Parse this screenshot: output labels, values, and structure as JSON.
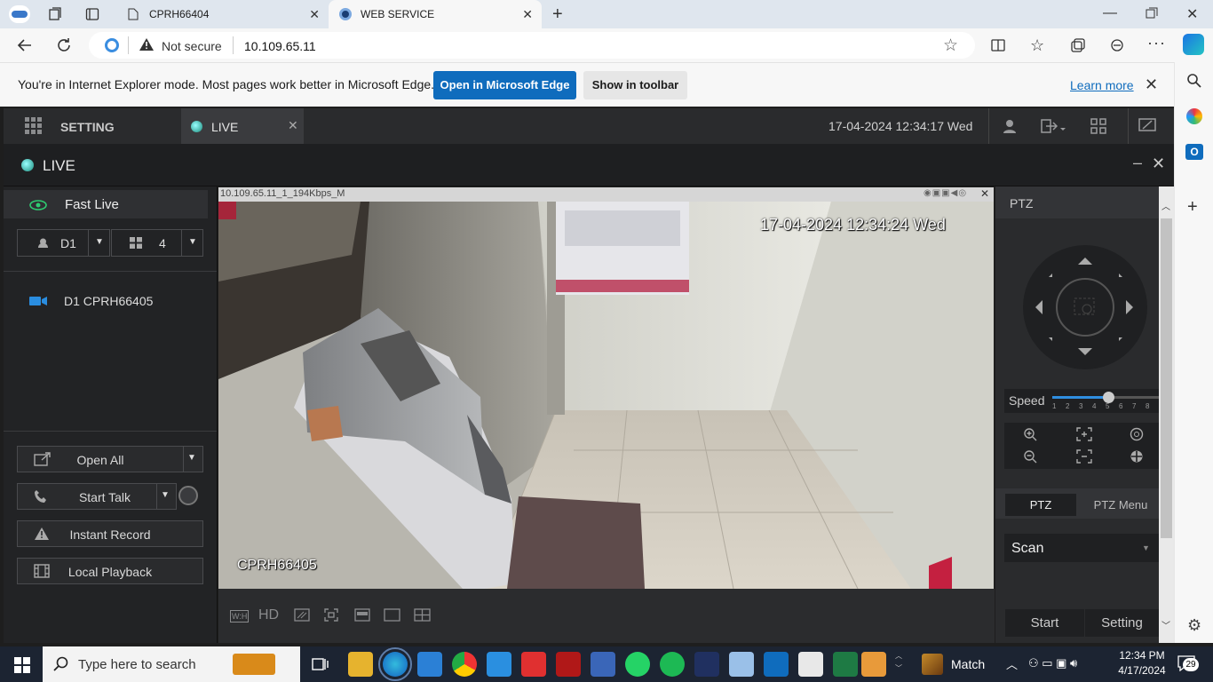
{
  "browser": {
    "tabs": [
      {
        "title": "CPRH66404"
      },
      {
        "title": "WEB SERVICE"
      }
    ],
    "security": "Not secure",
    "url": "10.109.65.11"
  },
  "ie_bar": {
    "message": "You're in Internet Explorer mode. Most pages work better in Microsoft Edge.",
    "open_edge": "Open in Microsoft Edge",
    "show_toolbar": "Show in toolbar",
    "learn_more": "Learn more"
  },
  "app": {
    "setting_label": "SETTING",
    "live_tab": "LIVE",
    "datetime": "17-04-2024 12:34:17 Wed"
  },
  "live": {
    "title": "LIVE",
    "fast_live": "Fast Live",
    "device_select": "D1",
    "split_select": "4",
    "device_item": "D1 CPRH66405",
    "buttons": {
      "open_all": "Open All",
      "start_talk": "Start Talk",
      "instant_record": "Instant Record",
      "local_playback": "Local Playback"
    }
  },
  "video": {
    "stream_info": "10.109.65.11_1_194Kbps_M",
    "osd_time": "17-04-2024 12:34:24 Wed",
    "osd_name": "CPRH66405",
    "toolbar": {
      "wh": "W:H",
      "hd": "HD"
    }
  },
  "ptz": {
    "title": "PTZ",
    "speed_label": "Speed",
    "speed_value": 5,
    "speed_ticks": [
      "1",
      "2",
      "3",
      "4",
      "5",
      "6",
      "7",
      "8"
    ],
    "tab_ptz": "PTZ",
    "tab_menu": "PTZ Menu",
    "mode_select": "Scan",
    "start": "Start",
    "setting": "Setting"
  },
  "taskbar": {
    "search_placeholder": "Type here to search",
    "weather": "Match",
    "time": "12:34 PM",
    "date": "4/17/2024",
    "notifications": "29"
  },
  "colors": {
    "edge_blue": "#0f6cbd",
    "app_dark": "#2a2b2d",
    "live_green": "#2ecc71",
    "slider_blue": "#2f8ee0"
  }
}
